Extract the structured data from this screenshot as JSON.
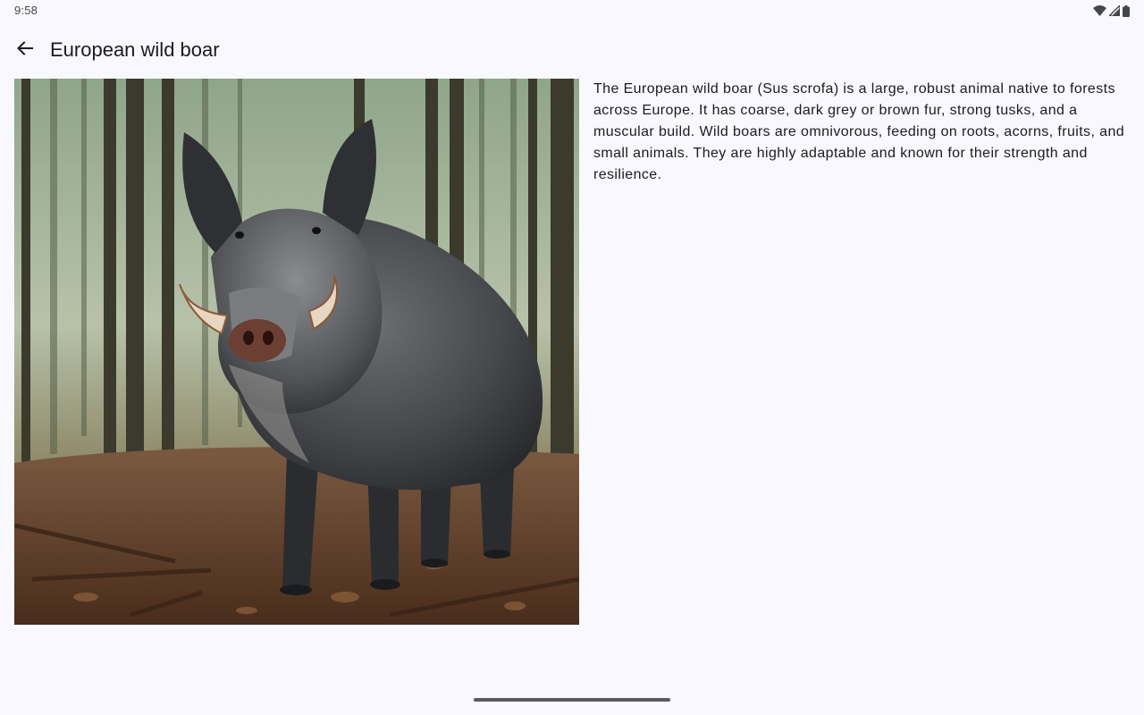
{
  "status_bar": {
    "time": "9:58",
    "icons": [
      "wifi-icon",
      "cellular-signal-icon",
      "battery-icon"
    ]
  },
  "app_bar": {
    "back_icon": "arrow-back-icon",
    "title": "European wild boar"
  },
  "content": {
    "image_subject": "European wild boar in forest",
    "description": "The European wild boar (Sus scrofa) is a large, robust animal native to forests across Europe. It has coarse, dark grey or brown fur, strong tusks, and a muscular build. Wild boars are omnivorous, feeding on roots, acorns, fruits, and small animals. They are highly adaptable and known for their strength and resilience."
  },
  "colors": {
    "background": "#f9f8ff",
    "text_primary": "#1b1b21",
    "text_secondary": "#44464f"
  }
}
